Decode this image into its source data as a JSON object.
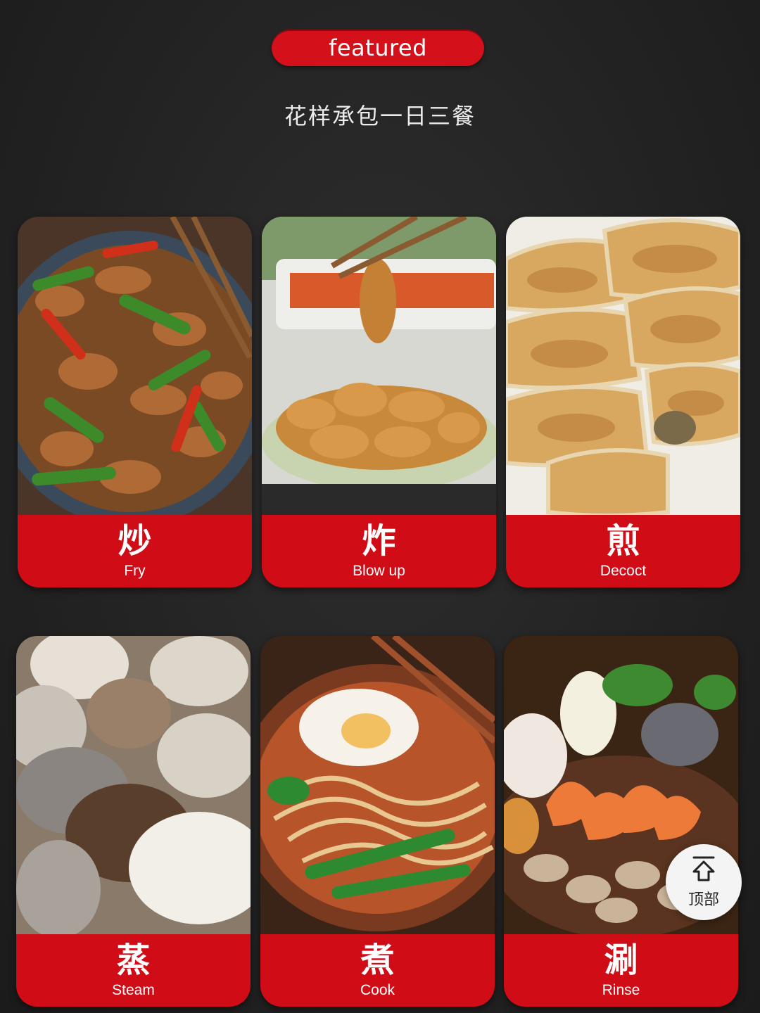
{
  "header": {
    "badge_label": "featured",
    "subtitle": "花样承包一日三餐"
  },
  "colors": {
    "accent_red": "#d00d17",
    "background": "#232323"
  },
  "cards": [
    {
      "cn": "炒",
      "en": "Fry",
      "icon": "stir-fried-pork-peppers-photo"
    },
    {
      "cn": "炸",
      "en": "Blow up",
      "icon": "fried-chicken-chopsticks-photo"
    },
    {
      "cn": "煎",
      "en": "Decoct",
      "icon": "pan-fried-dumplings-photo"
    },
    {
      "cn": "蒸",
      "en": "Steam",
      "icon": "steamed-buns-photo"
    },
    {
      "cn": "煮",
      "en": "Cook",
      "icon": "noodle-soup-photo"
    },
    {
      "cn": "涮",
      "en": "Rinse",
      "icon": "seafood-hotpot-photo"
    }
  ],
  "scroll_top": {
    "label": "顶部",
    "icon": "home-arrow-up-icon"
  }
}
